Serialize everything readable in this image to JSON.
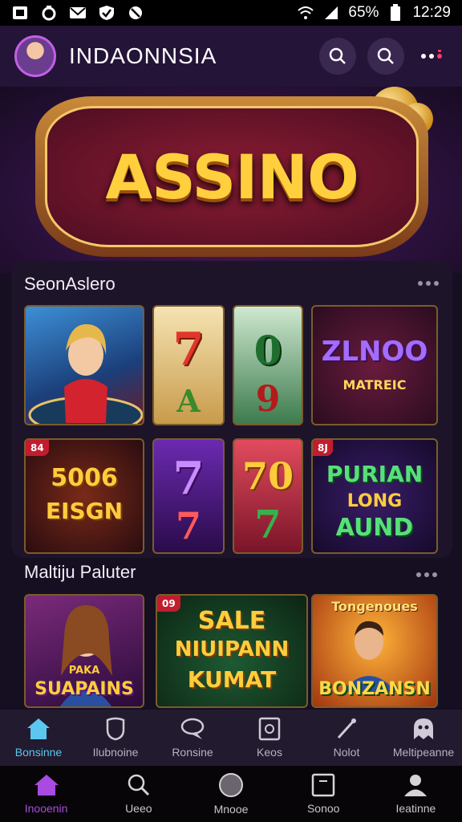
{
  "status_bar": {
    "battery": "65%",
    "time": "12:29"
  },
  "app": {
    "title": "INDAONNSIA"
  },
  "hero": {
    "logo_text": "ASSINO"
  },
  "section1": {
    "title": "SeonAslero",
    "tiles": [
      {
        "type": "image",
        "label": ""
      },
      {
        "type": "reel",
        "top": "7",
        "bottom": "A"
      },
      {
        "type": "reel",
        "top": "0",
        "bottom": "9"
      },
      {
        "type": "text",
        "line1": "ZLNOO",
        "line2": "MATREIC"
      },
      {
        "type": "text",
        "badge": "84",
        "line1": "5006",
        "line2": "EISGN"
      },
      {
        "type": "reel",
        "top": "7",
        "bottom": "7"
      },
      {
        "type": "reel",
        "top": "70",
        "bottom": "7"
      },
      {
        "type": "text",
        "badge": "8J",
        "line1": "PURIAN",
        "line2": "LONG",
        "line3": "AUND"
      }
    ]
  },
  "section2": {
    "title": "Maltiju Paluter",
    "tiles": [
      {
        "label": "SUAPAINS",
        "line0": "PAKA"
      },
      {
        "badge": "09",
        "line1": "SALE",
        "line2": "NIUIPANN",
        "line3": "KUMAT"
      },
      {
        "header": "Tongenoues",
        "label": "BONZANSN"
      }
    ]
  },
  "categories": [
    {
      "label": "Bonsinne",
      "icon": "home-icon",
      "active": true
    },
    {
      "label": "Ilubnoine",
      "icon": "shield-icon",
      "active": false
    },
    {
      "label": "Ronsine",
      "icon": "chat-icon",
      "active": false
    },
    {
      "label": "Keos",
      "icon": "card-icon",
      "active": false
    },
    {
      "label": "Nolot",
      "icon": "pen-icon",
      "active": false
    },
    {
      "label": "Meltipeanne",
      "icon": "ghost-icon",
      "active": false
    }
  ],
  "nav": [
    {
      "label": "Inooenin",
      "icon": "home-icon",
      "active": true
    },
    {
      "label": "Ueeo",
      "icon": "search-icon",
      "active": false
    },
    {
      "label": "Mnooe",
      "icon": "circle-icon",
      "active": false
    },
    {
      "label": "Sonoo",
      "icon": "window-icon",
      "active": false
    },
    {
      "label": "Ieatinne",
      "icon": "profile-icon",
      "active": false
    }
  ],
  "colors": {
    "accent_purple": "#a94be0",
    "accent_blue": "#5bc7f0",
    "gold": "#ffcf3d"
  }
}
